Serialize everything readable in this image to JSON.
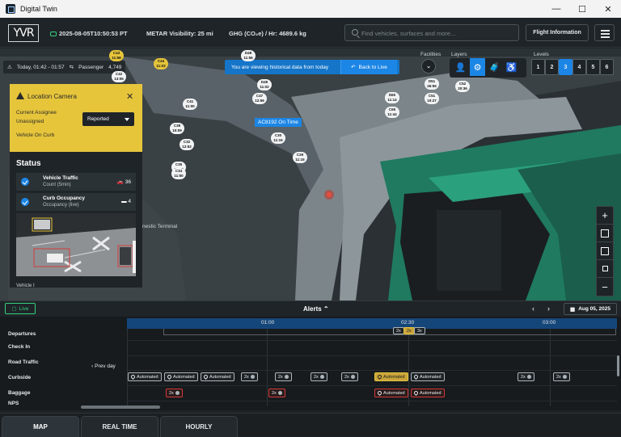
{
  "window": {
    "title": "Digital Twin",
    "controls": [
      "—",
      "☐",
      "✕"
    ]
  },
  "header": {
    "logo": "YVR",
    "datetime": "2025-08-05T10:50:53 PT",
    "metar": "METAR Visibility: 25 mi",
    "ghg": "GHG (CO₂e) / Hr: 4689.6 kg",
    "search_placeholder": "Find vehicles, surfaces and more...",
    "flight_info": "Flight Information"
  },
  "map": {
    "today_range": "Today, 01:42 - 01:57",
    "passenger_label": "Passenger",
    "passenger_count": "4,749",
    "banner_message": "You are viewing historical data from today",
    "back_to_live": "Back to Live",
    "facilities_label": "Facilities",
    "layers_label": "Layers",
    "levels_label": "Levels",
    "levels": [
      "1",
      "2",
      "3",
      "4",
      "5",
      "6"
    ],
    "active_level": "3",
    "flight_tag": "AC8192 On Time",
    "terminal_label": "nestic Terminal",
    "markers": [
      {
        "code": "C43",
        "time": "11:58"
      },
      {
        "code": "C44",
        "time": "11:03"
      },
      {
        "code": "D48",
        "time": "11:56"
      },
      {
        "code": "D49",
        "time": "11:02"
      },
      {
        "code": "C47",
        "time": "12:56"
      },
      {
        "code": "C41",
        "time": "11:00"
      },
      {
        "code": "C39",
        "time": "10:09"
      },
      {
        "code": "C32",
        "time": "12:52"
      },
      {
        "code": "C35",
        "time": "11:07"
      },
      {
        "code": "C34",
        "time": "11:50"
      },
      {
        "code": "C30",
        "time": "11:15"
      },
      {
        "code": "C29",
        "time": "11:15"
      },
      {
        "code": "D51",
        "time": "26:55"
      },
      {
        "code": "C52",
        "time": "20:36"
      },
      {
        "code": "D50",
        "time": "06:44"
      },
      {
        "code": "C51",
        "time": "10:27"
      },
      {
        "code": "D60",
        "time": "11:14"
      },
      {
        "code": "C65",
        "time": "11:44"
      },
      {
        "code": "C42",
        "time": "13:05"
      }
    ]
  },
  "location_camera": {
    "title": "Location Camera",
    "assignee_label": "Current Assignee",
    "assignee_value": "Unassigned",
    "note": "Vehicle On Curb",
    "status_select": "Reported"
  },
  "status_panel": {
    "title": "Status",
    "rows": [
      {
        "name": "Vehicle Traffic",
        "sub": "Count (5min)",
        "count": "36"
      },
      {
        "name": "Curb Occupancy",
        "sub": "Occupancy (live)",
        "count": "4"
      }
    ],
    "footer": "Vehicle I"
  },
  "timeline_bar": {
    "live": "Live",
    "alerts": "Alerts",
    "date": "Aug 05, 2025"
  },
  "timeline": {
    "ticks": [
      "01:00",
      "02:30",
      "03:00"
    ],
    "rows": [
      "Departures",
      "Check In",
      "Road Traffic",
      "Curbside",
      "Baggage",
      "NPS"
    ],
    "prev_day": "Prev day",
    "header_badges": [
      "2x",
      "2x",
      "3x"
    ],
    "curbside": [
      {
        "label": "Automated",
        "style": "default"
      },
      {
        "label": "Automated",
        "style": "default"
      },
      {
        "label": "Automated",
        "style": "default"
      },
      {
        "label": "2x",
        "style": "default"
      },
      {
        "label": "2x",
        "style": "default"
      },
      {
        "label": "2x",
        "style": "default"
      },
      {
        "label": "2x",
        "style": "default"
      },
      {
        "label": "Automated",
        "style": "gold"
      },
      {
        "label": "Automated",
        "style": "default"
      },
      {
        "label": "2x",
        "style": "default"
      },
      {
        "label": "2x",
        "style": "default"
      }
    ],
    "baggage": [
      {
        "label": "2x",
        "style": "red"
      },
      {
        "label": "2x",
        "style": "red"
      },
      {
        "label": "Automated",
        "style": "red"
      },
      {
        "label": "Automated",
        "style": "red"
      }
    ]
  },
  "tabs": [
    "MAP",
    "REAL TIME",
    "HOURLY"
  ],
  "colors": {
    "accent": "#1c86e6",
    "warning": "#e6c53b",
    "live": "#33d17a",
    "alert": "#d23a3a",
    "airside": "#1f7a60"
  }
}
